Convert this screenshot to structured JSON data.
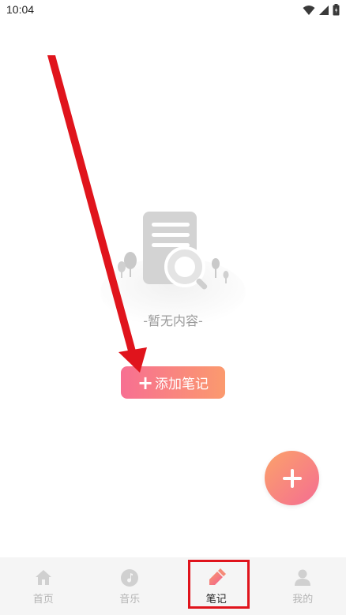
{
  "status_bar": {
    "time": "10:04",
    "icons": [
      "wifi-icon",
      "cellular-signal-icon",
      "battery-icon"
    ]
  },
  "empty_state": {
    "illustration": "empty-document-search-illustration",
    "text": "-暂无内容-"
  },
  "add_note_button": {
    "icon": "plus-icon",
    "label": "添加笔记"
  },
  "fab": {
    "icon": "plus-icon"
  },
  "tabbar": {
    "active_index": 2,
    "items": [
      {
        "label": "首页",
        "icon": "home-icon"
      },
      {
        "label": "音乐",
        "icon": "music-icon"
      },
      {
        "label": "笔记",
        "icon": "note-icon"
      },
      {
        "label": "我的",
        "icon": "user-icon"
      }
    ]
  },
  "colors": {
    "accent_start": "#f76f92",
    "accent_end": "#fb9a6e",
    "annotation_red": "#e0141c",
    "muted_gray": "#b5b5b5"
  },
  "annotations": {
    "arrow": "red-arrow-pointing-to-add-note",
    "highlight": "red-box-around-notes-tab"
  }
}
